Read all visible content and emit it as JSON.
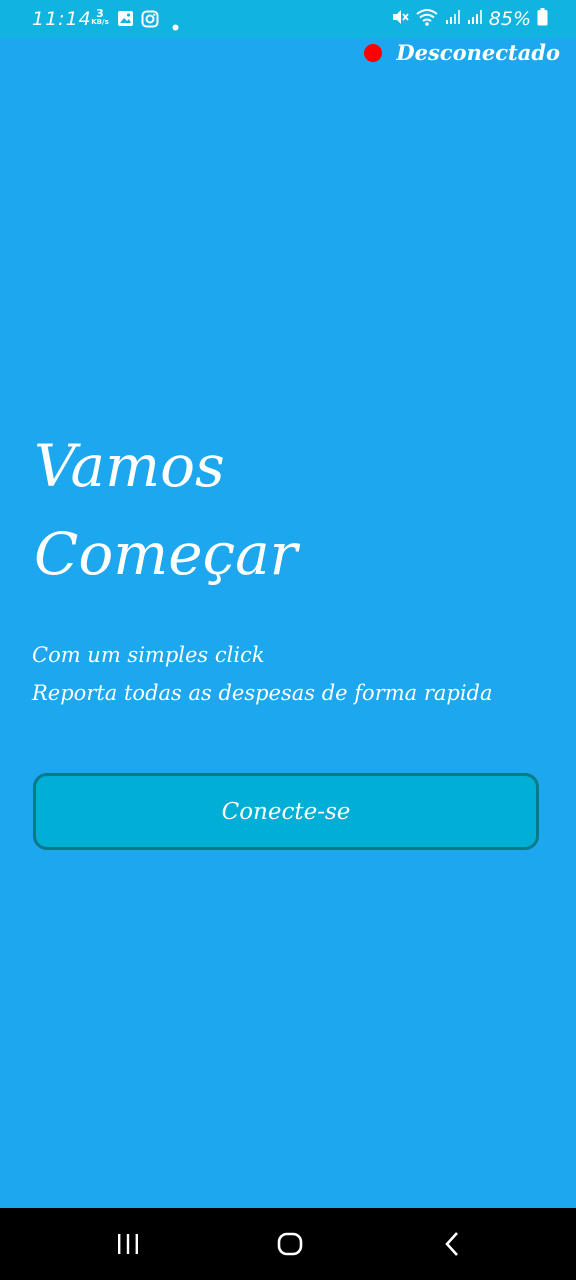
{
  "status_bar": {
    "time": "11:14",
    "net_speed_value": "3",
    "net_speed_unit": "KB/s",
    "battery": "85%",
    "icons": [
      "gallery-icon",
      "instagram-icon",
      "dot-icon",
      "mute-icon",
      "wifi-icon",
      "signal-icon",
      "signal-icon",
      "battery-icon"
    ]
  },
  "connection": {
    "status_text": "Desconectado",
    "status_color": "#ff0000"
  },
  "hero": {
    "title_line1": "Vamos",
    "title_line2": "Começar",
    "subtitle_line1": "Com um simples click",
    "subtitle_line2": "Reporta todas as despesas de forma rapida"
  },
  "actions": {
    "connect_label": "Conecte-se"
  },
  "nav_bar": {
    "icons": [
      "recent-apps-icon",
      "home-icon",
      "back-icon"
    ]
  },
  "colors": {
    "background": "#1ca7ee",
    "button": "#00aed6",
    "button_border": "#0a7a8a"
  }
}
